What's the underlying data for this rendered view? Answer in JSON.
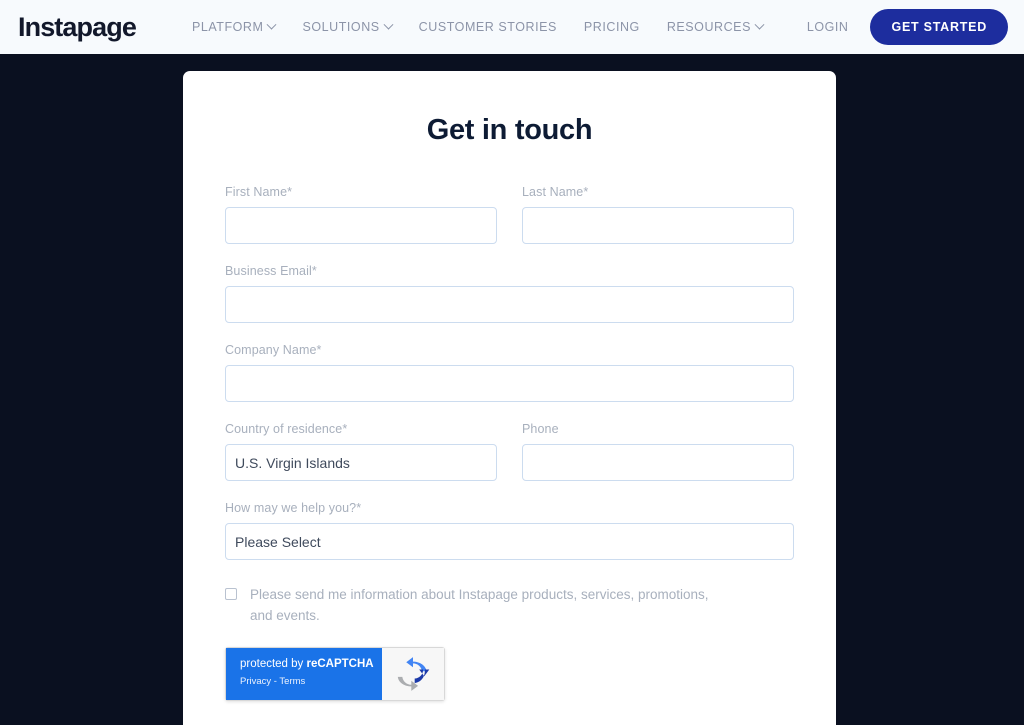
{
  "nav": {
    "brand": "Instapage",
    "links": [
      {
        "label": "PLATFORM",
        "caret": true
      },
      {
        "label": "SOLUTIONS",
        "caret": true
      },
      {
        "label": "CUSTOMER STORIES",
        "caret": false
      },
      {
        "label": "PRICING",
        "caret": false
      },
      {
        "label": "RESOURCES",
        "caret": true
      }
    ],
    "login_label": "LOGIN",
    "cta_label": "GET STARTED",
    "cta_color": "#1d2d9e",
    "background": "#f7fafd"
  },
  "page": {
    "background": "#0a1020"
  },
  "form": {
    "title": "Get in touch",
    "first_name": {
      "label": "First Name*",
      "value": "",
      "placeholder": ""
    },
    "last_name": {
      "label": "Last Name*",
      "value": "",
      "placeholder": ""
    },
    "business_email": {
      "label": "Business Email*",
      "value": "",
      "placeholder": ""
    },
    "company_name": {
      "label": "Company Name*",
      "value": "",
      "placeholder": ""
    },
    "country": {
      "label": "Country of residence*",
      "value": "U.S. Virgin Islands"
    },
    "phone": {
      "label": "Phone",
      "value": "",
      "placeholder": ""
    },
    "help": {
      "label": "How may we help you?*",
      "value": "Please Select"
    },
    "consent": {
      "checked": false,
      "text": "Please send me information about Instapage products, services, promotions, and events."
    }
  },
  "recaptcha": {
    "title_prefix": "protected by ",
    "title_brand": "reCAPTCHA",
    "privacy_label": "Privacy - Terms",
    "panel_color": "#1a73e8"
  }
}
